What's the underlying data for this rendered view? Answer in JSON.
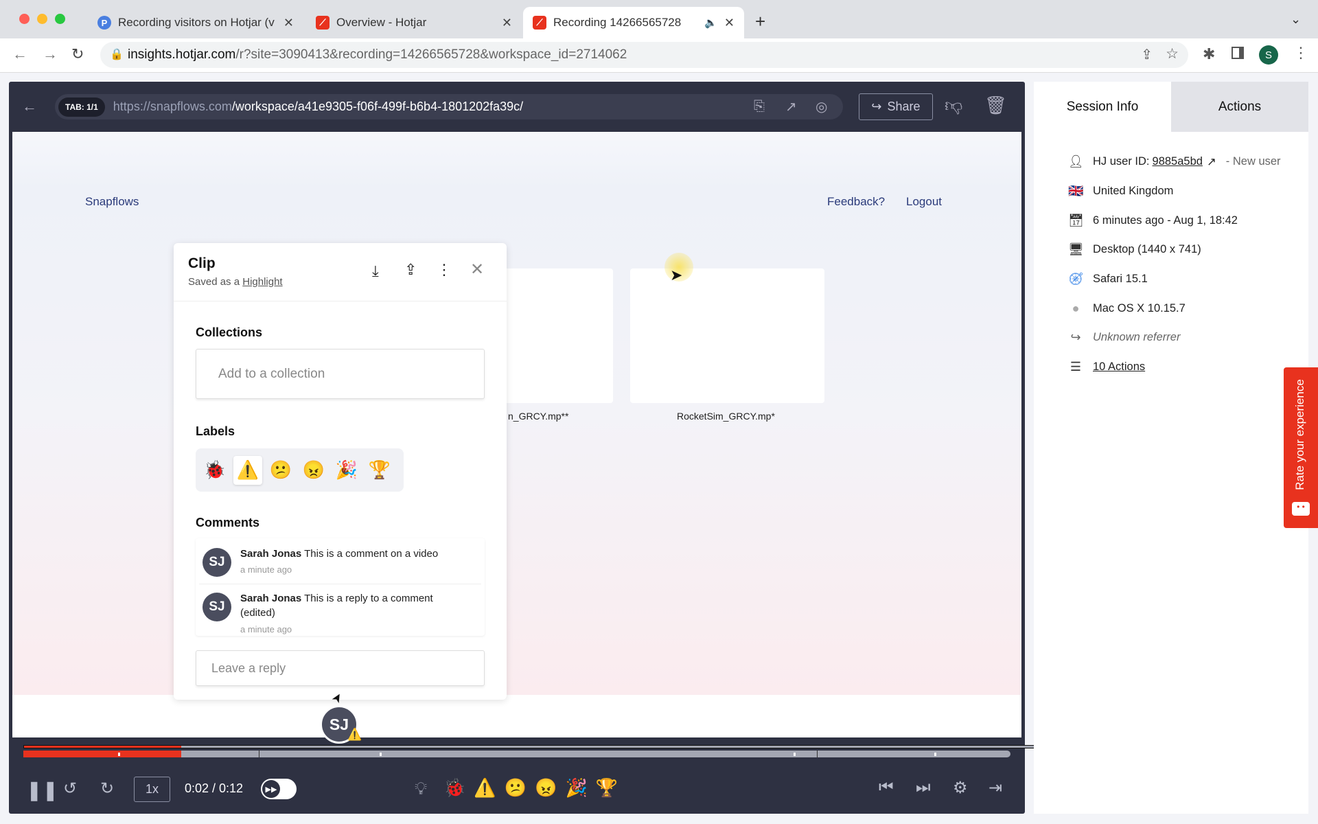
{
  "browser": {
    "tabs": [
      {
        "title": "Recording visitors on Hotjar (v",
        "favicon": "P"
      },
      {
        "title": "Overview - Hotjar",
        "favicon": "hotjar"
      },
      {
        "title": "Recording 14266565728",
        "favicon": "hotjar",
        "active": true
      }
    ],
    "url_host": "insights.hotjar.com",
    "url_path": "/r?site=3090413&recording=14266565728&workspace_id=2714062",
    "profile_initial": "S"
  },
  "player": {
    "tab_badge": "TAB: 1/1",
    "url_host": "https://snapflows.com",
    "url_path": "/workspace/a41e9305-f06f-499f-b6b4-1801202fa39c/",
    "share_label": "Share",
    "speed": "1x",
    "time": "0:02 / 0:12",
    "progress_percent": 16.7
  },
  "site": {
    "brand": "Snapflows",
    "feedback": "Feedback?",
    "logout": "Logout",
    "cards": [
      "RocketSim_GRCY.mp**",
      "RocketSim_GRCY.mp*"
    ],
    "card1_visible": "n_GRCY.mp**"
  },
  "clip": {
    "title": "Clip",
    "saved_as": "Saved as a",
    "highlight": "Highlight",
    "collections_heading": "Collections",
    "collection_placeholder": "Add to a collection",
    "labels_heading": "Labels",
    "labels": [
      "🐞",
      "⚠️",
      "😕",
      "😠",
      "🎉",
      "🏆"
    ],
    "selected_label": "⚠️",
    "comments_heading": "Comments",
    "comments": [
      {
        "initials": "SJ",
        "author": "Sarah Jonas",
        "text": "This is a comment on a video",
        "time": "a minute ago"
      },
      {
        "initials": "SJ",
        "author": "Sarah Jonas",
        "text": "This is a reply to a comment (edited)",
        "time": "a minute ago"
      }
    ],
    "reply_placeholder": "Leave a reply",
    "marker_initials": "SJ"
  },
  "session": {
    "tabs": [
      "Session Info",
      "Actions"
    ],
    "user_id_label": "HJ user ID:",
    "user_id": "9885a5bd",
    "new_user": "- New user",
    "country": "United Kingdom",
    "time": "6 minutes ago - Aug 1, 18:42",
    "device": "Desktop (1440 x 741)",
    "browser": "Safari 15.1",
    "os": "Mac OS X 10.15.7",
    "referrer": "Unknown referrer",
    "actions": "10 Actions"
  },
  "rate": "Rate your experience",
  "colors": {
    "accent": "#e8321e",
    "player_bg": "#2e3142"
  }
}
